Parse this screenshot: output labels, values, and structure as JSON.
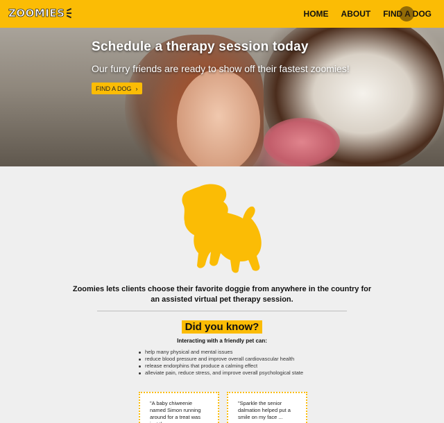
{
  "header": {
    "logo": "ZOOMIES",
    "nav": [
      "HOME",
      "ABOUT",
      "FIND A DOG"
    ]
  },
  "hero": {
    "title": "Schedule a therapy session today",
    "subtitle": "Our furry friends are ready to show off their fastest zoomies!",
    "button_label": "FIND A DOG",
    "button_icon": "chevron-right-icon"
  },
  "main": {
    "intro": "Zoomies lets clients choose their favorite doggie from anywhere in the country for an assisted virtual pet therapy session.",
    "did_you_know_title": "Did you know?",
    "did_you_know_subtitle": "Interacting with a friendly pet can:",
    "facts": [
      "help many physical and mental issues",
      "reduce blood pressure and improve overall cardiovascular health",
      "release endorphins that produce a calming effect",
      "alleviate pain, reduce stress, and improve overall psychological state"
    ],
    "testimonials": [
      "\"A baby chiweenie named Simon running around for a treat was just the ...",
      "\"Sparkle the senior dalmation helped put a smile on my face ..."
    ]
  },
  "colors": {
    "accent": "#fbbc05",
    "background": "#efefef",
    "text": "#111111"
  }
}
